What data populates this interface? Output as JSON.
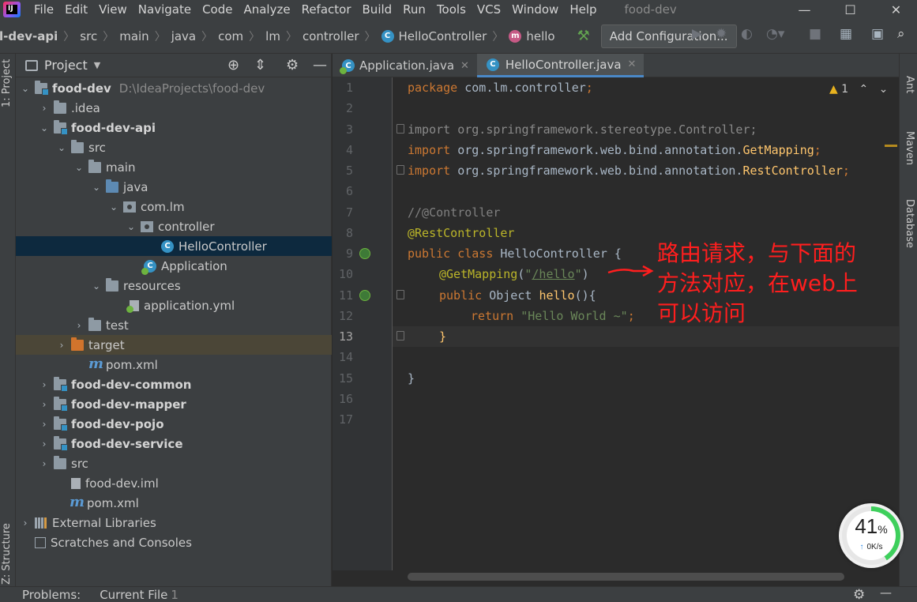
{
  "window": {
    "project_name": "food-dev",
    "menu": [
      "File",
      "Edit",
      "View",
      "Navigate",
      "Code",
      "Analyze",
      "Refactor",
      "Build",
      "Run",
      "Tools",
      "VCS",
      "Window",
      "Help"
    ],
    "logo_text": "IJ",
    "controls": {
      "minimize": "—",
      "maximize": "☐",
      "close": "✕"
    }
  },
  "breadcrumb": {
    "items": [
      "l-dev-api",
      "src",
      "main",
      "java",
      "com",
      "lm",
      "controller"
    ],
    "class_item": "HelloController",
    "method_item": "hello",
    "class_letter": "C",
    "method_letter": "m"
  },
  "toolbar": {
    "add_config_label": "Add Configuration...",
    "icons": [
      "build-hammer",
      "run",
      "debug",
      "coverage",
      "profile",
      "stop",
      "project-structure",
      "terminal",
      "search"
    ]
  },
  "left_strip": {
    "project_label": "1: Project",
    "structure_label": "Z: Structure"
  },
  "right_strip": {
    "ant_label": "Ant",
    "maven_label": "Maven",
    "database_label": "Database"
  },
  "project_panel": {
    "title": "Project",
    "tree": [
      {
        "label": "food-dev",
        "hint": "D:\\IdeaProjects\\food-dev",
        "bold": true
      },
      {
        "label": ".idea"
      },
      {
        "label": "food-dev-api",
        "bold": true
      },
      {
        "label": "src"
      },
      {
        "label": "main"
      },
      {
        "label": "java"
      },
      {
        "label": "com.lm"
      },
      {
        "label": "controller"
      },
      {
        "label": "HelloController",
        "selected": true
      },
      {
        "label": "Application"
      },
      {
        "label": "resources"
      },
      {
        "label": "application.yml"
      },
      {
        "label": "test"
      },
      {
        "label": "target",
        "orange": true
      },
      {
        "label": "pom.xml"
      },
      {
        "label": "food-dev-common",
        "bold": true
      },
      {
        "label": "food-dev-mapper",
        "bold": true
      },
      {
        "label": "food-dev-pojo",
        "bold": true
      },
      {
        "label": "food-dev-service",
        "bold": true
      },
      {
        "label": "src"
      },
      {
        "label": "food-dev.iml"
      },
      {
        "label": "pom.xml"
      },
      {
        "label": "External Libraries"
      },
      {
        "label": "Scratches and Consoles"
      }
    ]
  },
  "editor": {
    "tabs": [
      {
        "label": "Application.java",
        "active": false
      },
      {
        "label": "HelloController.java",
        "active": true
      }
    ],
    "line_numbers": [
      "1",
      "2",
      "3",
      "4",
      "5",
      "6",
      "7",
      "8",
      "9",
      "10",
      "11",
      "12",
      "13",
      "14",
      "15",
      "16",
      "17"
    ],
    "current_line": "13",
    "code": {
      "l1_kw": "package",
      "l1_rest": " com.lm.controller",
      "l1_semi": ";",
      "l3_kw": "import",
      "l3_rest": " org.springframework.stereotype.Controller;",
      "l4_kw": "import",
      "l4_rest": " org.springframework.web.bind.annotation.",
      "l4_cls": "GetMapping",
      "l4_semi": ";",
      "l5_kw": "import",
      "l5_rest": " org.springframework.web.bind.annotation.",
      "l5_cls": "RestController",
      "l5_semi": ";",
      "l7_comment": "//@Controller",
      "l8_ann": "@RestController",
      "l9_kw": "public class",
      "l9_rest": " HelloController {",
      "l10_ann": "@GetMapping",
      "l10_open": "(",
      "l10_q1": "\"",
      "l10_path": "/hello",
      "l10_q2": "\"",
      "l10_close": ")",
      "l11_kw": "public",
      "l11_type": " Object ",
      "l11_fn": "hello",
      "l11_rest": "(){",
      "l12_kw": "return",
      "l12_str": " \"Hello World ~\"",
      "l12_semi": ";",
      "l13_brace": "}",
      "l15_brace": "}"
    },
    "warning_count": "1",
    "warning_symbol": "▲"
  },
  "annotation": {
    "line1": "路由请求，与下面的",
    "line2": "方法对应，在web上",
    "line3": "可以访问",
    "color": "#ff1e1e"
  },
  "network_widget": {
    "percent": "41",
    "percent_sign": "%",
    "rate": "0K/s",
    "rate_arrow": "↑",
    "fill_fraction": 0.41
  },
  "bottom_bar": {
    "problems_label": "Problems:",
    "current_file_label": "Current File",
    "current_file_count": "1"
  }
}
